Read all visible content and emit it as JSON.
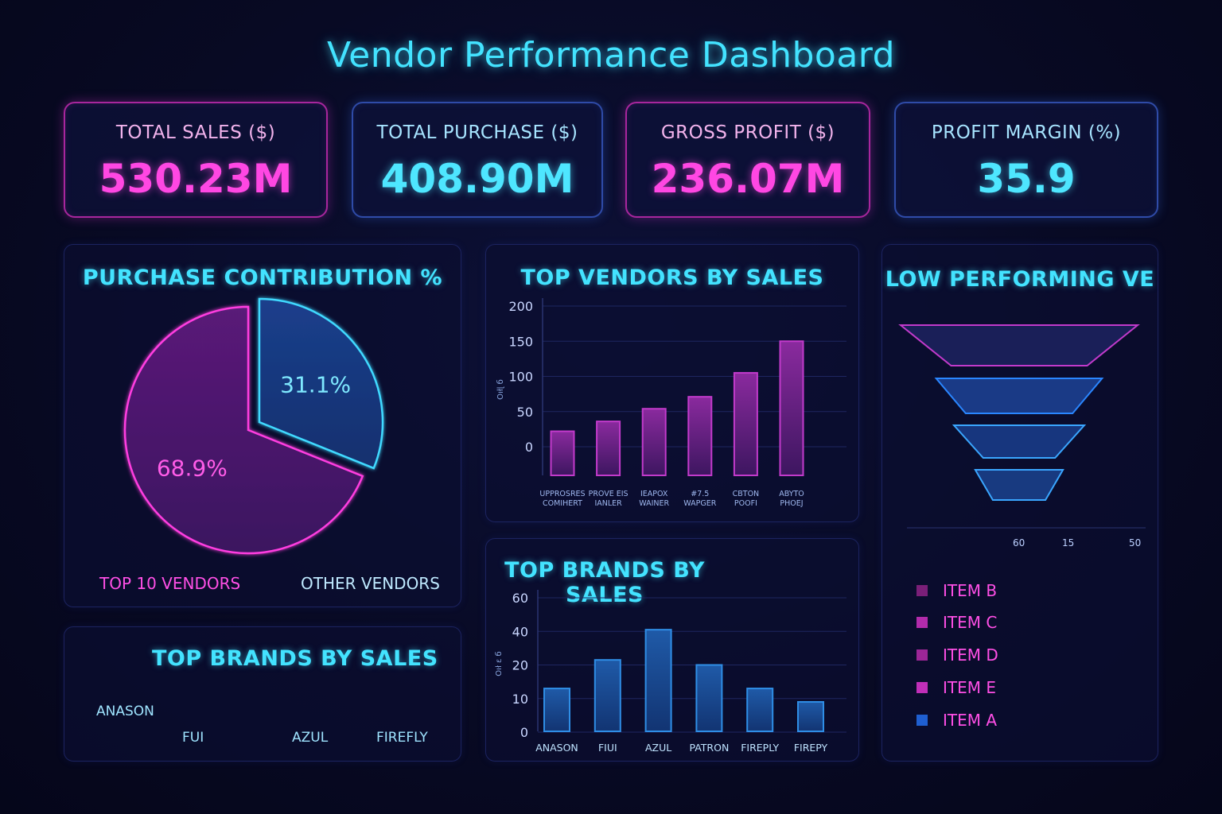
{
  "dashboard_title": "Vendor Performance Dashboard",
  "kpis": [
    {
      "label": "TOTAL SALES ($)",
      "value": "530.23M",
      "accent": "#ff47e3"
    },
    {
      "label": "TOTAL PURCHASE ($)",
      "value": "408.90M",
      "accent": "#4ee6ff"
    },
    {
      "label": "GROSS PROFIT ($)",
      "value": "236.07M",
      "accent": "#ff47e3"
    },
    {
      "label": "PROFIT MARGIN (%)",
      "value": "35.9",
      "accent": "#4ee6ff"
    }
  ],
  "colors": {
    "magenta": "#ff3ee0",
    "cyan": "#3fd9ff",
    "blue": "#2a6fe0",
    "background": "#080a24"
  },
  "purchase_panel": {
    "title": "PURCHASE CONTRIBUTION %",
    "legend_top10": "TOP 10 VENDORS",
    "legend_other": "OTHER VENDORS"
  },
  "vendors_panel": {
    "title": "TOP VENDORS BY SALES",
    "ylabel": "Oıłɭ б"
  },
  "brands_panel": {
    "title": "TOP BRANDS BY SALES",
    "ylabel": "Oıł ɛ б"
  },
  "brands_text_panel": {
    "title": "TOP BRANDS BY SALES",
    "labels": [
      "ANASON",
      "FUI",
      "AZUL",
      "FIREFLY"
    ]
  },
  "low_panel": {
    "title": "LOW PERFORMING VE",
    "ticks": [
      "60",
      "15",
      "50"
    ],
    "legend": [
      {
        "label": "ITEM B",
        "color": "#7a1f78"
      },
      {
        "label": "ITEM C",
        "color": "#b22bab"
      },
      {
        "label": "ITEM D",
        "color": "#9c2696"
      },
      {
        "label": "ITEM E",
        "color": "#c02fb8"
      },
      {
        "label": "ITEM A",
        "color": "#1f5fd0"
      }
    ]
  },
  "chart_data": [
    {
      "type": "pie",
      "title": "PURCHASE CONTRIBUTION %",
      "labels": [
        "TOP 10 VENDORS",
        "OTHER VENDORS"
      ],
      "values": [
        68.9,
        31.1
      ],
      "value_labels": [
        "68.9%",
        "31.1%"
      ],
      "legend": "bottom"
    },
    {
      "type": "bar",
      "title": "TOP VENDORS BY SALES",
      "categories": [
        "UPPROSRES COMIHERT",
        "PROVE EIS IANLER",
        "IEAPOX WAINER",
        "#7.5 WAPGER",
        "CBTON POOFI",
        "ABYTO PHOEJ"
      ],
      "values": [
        22,
        36,
        54,
        71,
        105,
        150
      ],
      "ylim": [
        0,
        200
      ],
      "yticks": [
        0,
        50,
        100,
        150,
        200
      ],
      "grid": true
    },
    {
      "type": "bar",
      "title": "TOP BRANDS BY SALES",
      "categories": [
        "ANASON",
        "FIUI",
        "AZUL",
        "PATRON",
        "FIREPLY",
        "FIREPY"
      ],
      "values": [
        13,
        23,
        41,
        20,
        13,
        9
      ],
      "ylim": [
        0,
        60
      ],
      "yticks": [
        0,
        10,
        20,
        40,
        60
      ],
      "grid": true
    },
    {
      "type": "funnel",
      "title": "LOW PERFORMING VE",
      "stages": [
        "ITEM B",
        "ITEM C",
        "ITEM D",
        "ITEM E"
      ],
      "values": [
        100,
        70,
        55,
        37
      ],
      "xticks": [
        "60",
        "15",
        "50"
      ]
    }
  ]
}
